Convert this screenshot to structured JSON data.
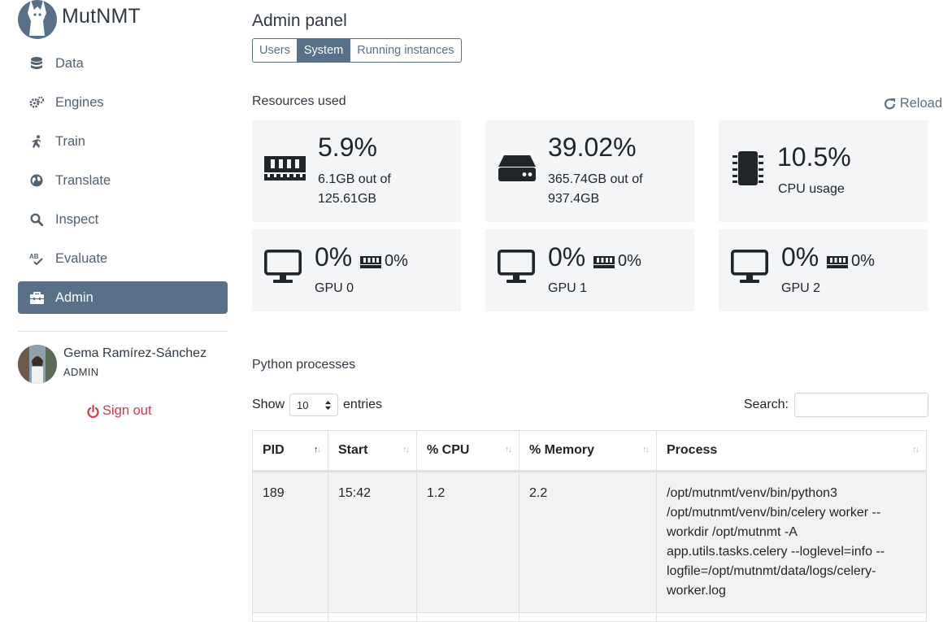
{
  "app": {
    "name": "MutNMT"
  },
  "colors": {
    "accent": "#587188",
    "danger": "#dc3545",
    "card_bg": "#f4f5f6"
  },
  "sidebar": {
    "items": [
      {
        "label": "Data",
        "icon": "database-icon"
      },
      {
        "label": "Engines",
        "icon": "cogs-icon"
      },
      {
        "label": "Train",
        "icon": "running-icon"
      },
      {
        "label": "Translate",
        "icon": "globe-icon"
      },
      {
        "label": "Inspect",
        "icon": "search-icon"
      },
      {
        "label": "Evaluate",
        "icon": "spell-check-icon"
      },
      {
        "label": "Admin",
        "icon": "toolbox-icon",
        "active": true
      }
    ],
    "user": {
      "name": "Gema Ramírez-Sánchez",
      "role": "ADMIN"
    },
    "signout_label": "Sign out"
  },
  "main": {
    "title": "Admin panel",
    "tabs": [
      {
        "label": "Users"
      },
      {
        "label": "System",
        "active": true
      },
      {
        "label": "Running instances"
      }
    ],
    "resources_label": "Resources used",
    "reload_label": "Reload",
    "resources": {
      "ram": {
        "percent": "5.9%",
        "detail_line1": "6.1GB out of",
        "detail_line2": "125.61GB",
        "icon": "memory-icon"
      },
      "disk": {
        "percent": "39.02%",
        "detail_line1": "365.74GB out of",
        "detail_line2": "937.4GB",
        "icon": "hdd-icon"
      },
      "cpu": {
        "percent": "10.5%",
        "detail": "CPU usage",
        "icon": "microchip-icon"
      }
    },
    "gpus": [
      {
        "usage": "0%",
        "memory": "0%",
        "label": "GPU 0"
      },
      {
        "usage": "0%",
        "memory": "0%",
        "label": "GPU 1"
      },
      {
        "usage": "0%",
        "memory": "0%",
        "label": "GPU 2"
      }
    ],
    "processes_label": "Python processes",
    "table_controls": {
      "show_label": "Show",
      "page_size": "10",
      "entries_label": "entries",
      "search_label": "Search:",
      "search_value": ""
    },
    "table": {
      "columns": [
        "PID",
        "Start",
        "% CPU",
        "% Memory",
        "Process"
      ],
      "rows": [
        {
          "pid": "189",
          "start": "15:42",
          "cpu": "1.2",
          "memory": "2.2",
          "process_lines": [
            "/opt/mutnmt/venv/bin/python3",
            "/opt/mutnmt/venv/bin/celery worker --",
            "workdir /opt/mutnmt -A",
            "app.utils.tasks.celery --loglevel=info --",
            "logfile=/opt/mutnmt/data/logs/celery-",
            "worker.log"
          ]
        }
      ]
    }
  }
}
